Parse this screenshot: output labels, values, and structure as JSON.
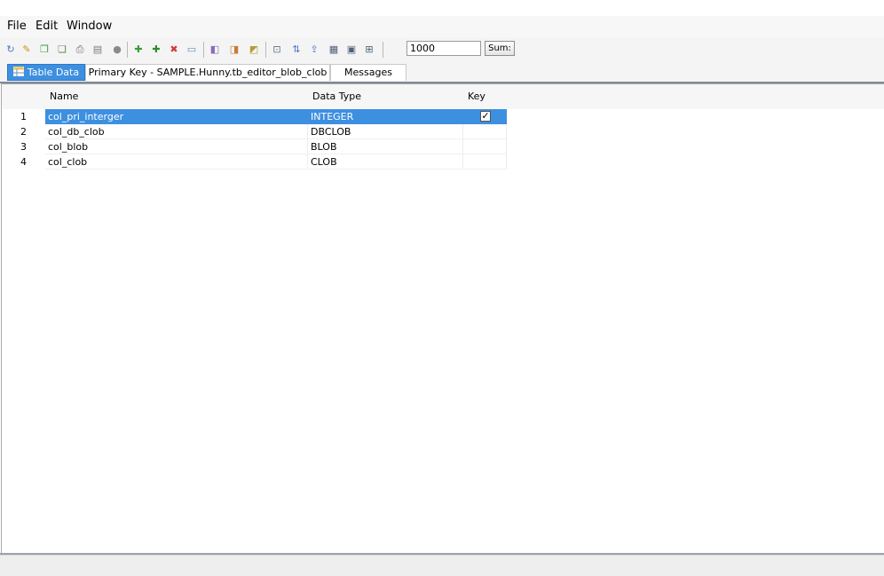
{
  "menu": {
    "file": "File",
    "edit": "Edit",
    "window": "Window"
  },
  "toolbar": {
    "icons": [
      {
        "name": "refresh-icon",
        "glyph": "↻",
        "color": "#4a79c7"
      },
      {
        "name": "run-icon",
        "glyph": "✎",
        "color": "#d98b1c"
      },
      {
        "name": "copy-rows-icon",
        "glyph": "❐",
        "color": "#3e9a45"
      },
      {
        "name": "paste-rows-icon",
        "glyph": "❏",
        "color": "#5a8a4a"
      },
      {
        "name": "print-icon",
        "glyph": "⎙",
        "color": "#6a6a6a"
      },
      {
        "name": "clipboard-icon",
        "glyph": "▤",
        "color": "#7a7a7a"
      },
      {
        "name": "stop-icon",
        "glyph": "●",
        "color": "#8a8a8a"
      },
      {
        "name": "insert-row-icon",
        "glyph": "✚",
        "color": "#3a9c3a"
      },
      {
        "name": "add-row-icon",
        "glyph": "✚",
        "color": "#2e8b2e"
      },
      {
        "name": "delete-row-icon",
        "glyph": "✖",
        "color": "#d03a3a"
      },
      {
        "name": "edit-cell-icon",
        "glyph": "▭",
        "color": "#6a8fb8"
      },
      {
        "name": "commit-icon",
        "glyph": "◧",
        "color": "#8a6bb8"
      },
      {
        "name": "rollback-icon",
        "glyph": "◨",
        "color": "#c87a3a"
      },
      {
        "name": "filter-icon",
        "glyph": "◩",
        "color": "#b89a3a"
      },
      {
        "name": "zoom-icon",
        "glyph": "⊡",
        "color": "#5f6f86"
      },
      {
        "name": "sort-icon",
        "glyph": "⇅",
        "color": "#4a79c7"
      },
      {
        "name": "export-icon",
        "glyph": "⇪",
        "color": "#4a79c7"
      },
      {
        "name": "grid-view-icon",
        "glyph": "▦",
        "color": "#4f5f78"
      },
      {
        "name": "form-view-icon",
        "glyph": "▣",
        "color": "#4f5f78"
      },
      {
        "name": "fetch-size-icon",
        "glyph": "⊞",
        "color": "#4f5f78"
      }
    ],
    "fetch_size": "1000",
    "sum_label": "Sum:"
  },
  "tabs": [
    {
      "label": "Table Data",
      "active": true
    },
    {
      "label": "Primary Key - SAMPLE.Hunny.tb_editor_blob_clob",
      "active": false
    },
    {
      "label": "Messages",
      "active": false
    }
  ],
  "grid": {
    "columns": [
      "Name",
      "Data Type",
      "Key"
    ],
    "rows": [
      {
        "num": "1",
        "name": "col_pri_interger",
        "type": "INTEGER",
        "key": true,
        "selected": true
      },
      {
        "num": "2",
        "name": "col_db_clob",
        "type": "DBCLOB",
        "key": false,
        "selected": false
      },
      {
        "num": "3",
        "name": "col_blob",
        "type": "BLOB",
        "key": false,
        "selected": false
      },
      {
        "num": "4",
        "name": "col_clob",
        "type": "CLOB",
        "key": false,
        "selected": false
      }
    ],
    "checkmark": "✓"
  },
  "colors": {
    "accent": "#3d8fe0"
  }
}
